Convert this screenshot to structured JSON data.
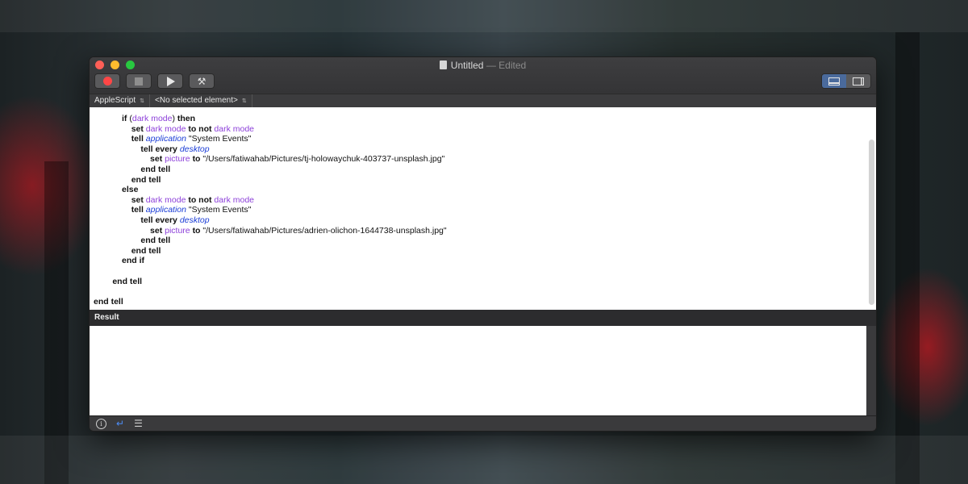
{
  "window": {
    "title": "Untitled",
    "title_suffix": "— Edited"
  },
  "toolbar": {
    "record_label": "Record",
    "stop_label": "Stop",
    "run_label": "Run",
    "compile_label": "Compile"
  },
  "navbar": {
    "language": "AppleScript",
    "element": "<No selected element>"
  },
  "code_lines": [
    [
      {
        "t": "            "
      },
      {
        "t": "if",
        "c": "kw"
      },
      {
        "t": " ("
      },
      {
        "t": "dark mode",
        "c": "var"
      },
      {
        "t": ") "
      },
      {
        "t": "then",
        "c": "kw"
      }
    ],
    [
      {
        "t": "                "
      },
      {
        "t": "set",
        "c": "kw"
      },
      {
        "t": " "
      },
      {
        "t": "dark mode",
        "c": "var"
      },
      {
        "t": " "
      },
      {
        "t": "to not",
        "c": "kw"
      },
      {
        "t": " "
      },
      {
        "t": "dark mode",
        "c": "var"
      }
    ],
    [
      {
        "t": "                "
      },
      {
        "t": "tell",
        "c": "kw"
      },
      {
        "t": " "
      },
      {
        "t": "application",
        "c": "app"
      },
      {
        "t": " \"System Events\""
      }
    ],
    [
      {
        "t": "                    "
      },
      {
        "t": "tell every",
        "c": "kw"
      },
      {
        "t": " "
      },
      {
        "t": "desktop",
        "c": "app"
      }
    ],
    [
      {
        "t": "                        "
      },
      {
        "t": "set",
        "c": "kw"
      },
      {
        "t": " "
      },
      {
        "t": "picture",
        "c": "var"
      },
      {
        "t": " "
      },
      {
        "t": "to",
        "c": "kw"
      },
      {
        "t": " \"/Users/fatiwahab/Pictures/tj-holowaychuk-403737-unsplash.jpg\""
      }
    ],
    [
      {
        "t": "                    "
      },
      {
        "t": "end tell",
        "c": "kw"
      }
    ],
    [
      {
        "t": "                "
      },
      {
        "t": "end tell",
        "c": "kw"
      }
    ],
    [
      {
        "t": "            "
      },
      {
        "t": "else",
        "c": "kw"
      }
    ],
    [
      {
        "t": "                "
      },
      {
        "t": "set",
        "c": "kw"
      },
      {
        "t": " "
      },
      {
        "t": "dark mode",
        "c": "var"
      },
      {
        "t": " "
      },
      {
        "t": "to not",
        "c": "kw"
      },
      {
        "t": " "
      },
      {
        "t": "dark mode",
        "c": "var"
      }
    ],
    [
      {
        "t": "                "
      },
      {
        "t": "tell",
        "c": "kw"
      },
      {
        "t": " "
      },
      {
        "t": "application",
        "c": "app"
      },
      {
        "t": " \"System Events\""
      }
    ],
    [
      {
        "t": "                    "
      },
      {
        "t": "tell every",
        "c": "kw"
      },
      {
        "t": " "
      },
      {
        "t": "desktop",
        "c": "app"
      }
    ],
    [
      {
        "t": "                        "
      },
      {
        "t": "set",
        "c": "kw"
      },
      {
        "t": " "
      },
      {
        "t": "picture",
        "c": "var"
      },
      {
        "t": " "
      },
      {
        "t": "to",
        "c": "kw"
      },
      {
        "t": " \"/Users/fatiwahab/Pictures/adrien-olichon-1644738-unsplash.jpg\""
      }
    ],
    [
      {
        "t": "                    "
      },
      {
        "t": "end tell",
        "c": "kw"
      }
    ],
    [
      {
        "t": "                "
      },
      {
        "t": "end tell",
        "c": "kw"
      }
    ],
    [
      {
        "t": "            "
      },
      {
        "t": "end if",
        "c": "kw"
      }
    ],
    [
      {
        "t": ""
      }
    ],
    [
      {
        "t": "        "
      },
      {
        "t": "end tell",
        "c": "kw"
      }
    ],
    [
      {
        "t": ""
      }
    ],
    [
      {
        "t": "end tell",
        "c": "kw"
      }
    ]
  ],
  "result": {
    "header": "Result"
  },
  "colors": {
    "keyword": "#111111",
    "variable": "#8c3fd9",
    "application_class": "#1a3cd6",
    "record_dot": "#ff4646"
  },
  "icons": {
    "record": "record-icon",
    "stop": "stop-icon",
    "run": "play-icon",
    "compile": "hammer-icon",
    "info": "info-icon",
    "replies": "return-arrow-icon",
    "log": "list-icon"
  }
}
